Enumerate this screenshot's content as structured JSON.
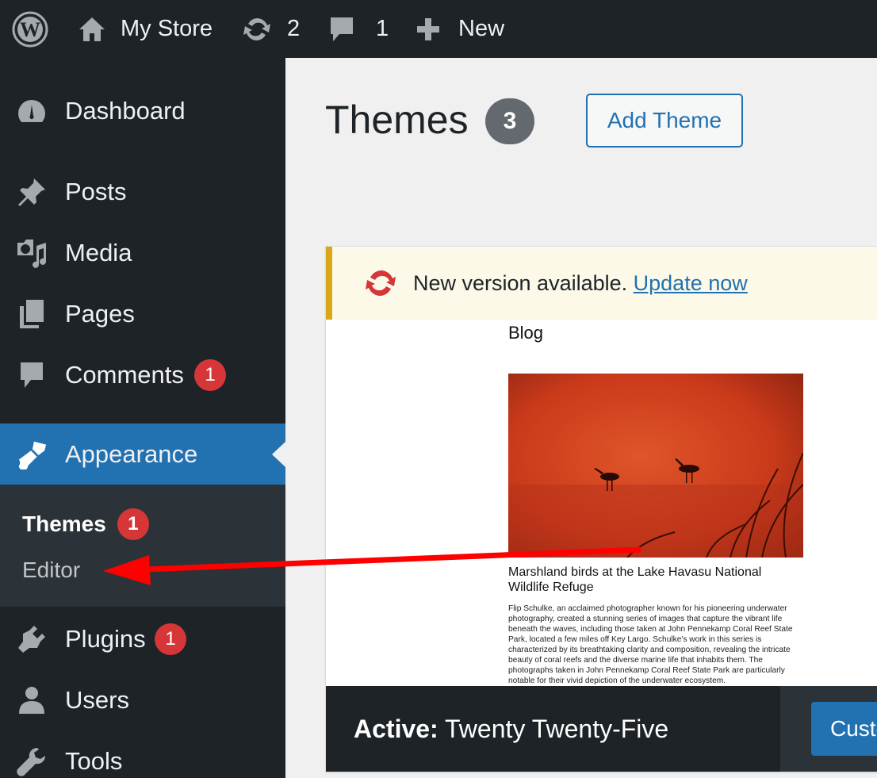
{
  "admin_bar": {
    "site_name": "My Store",
    "updates_count": "2",
    "comments_count": "1",
    "new_label": "New"
  },
  "sidebar": {
    "items": [
      {
        "label": "Dashboard",
        "icon": "dashboard-icon"
      },
      {
        "label": "Posts",
        "icon": "pin-icon"
      },
      {
        "label": "Media",
        "icon": "media-icon"
      },
      {
        "label": "Pages",
        "icon": "pages-icon"
      },
      {
        "label": "Comments",
        "icon": "comment-icon",
        "badge": "1"
      },
      {
        "label": "Appearance",
        "icon": "paintbrush-icon",
        "current": true
      },
      {
        "label": "Plugins",
        "icon": "plug-icon",
        "badge": "1"
      },
      {
        "label": "Users",
        "icon": "user-icon"
      },
      {
        "label": "Tools",
        "icon": "wrench-icon"
      }
    ],
    "submenu": [
      {
        "label": "Themes",
        "badge": "1",
        "active": true
      },
      {
        "label": "Editor"
      }
    ]
  },
  "main": {
    "title": "Themes",
    "count": "3",
    "add_button": "Add Theme"
  },
  "theme_card": {
    "notice_text": "New version available.",
    "notice_link": "Update now",
    "screenshot": {
      "heading": "Blog",
      "caption": "Marshland birds at the Lake Havasu National Wildlife Refuge",
      "body": "Flip Schulke, an acclaimed photographer known for his pioneering underwater photography, created a stunning series of images that capture the vibrant life beneath the waves, including those taken at John Pennekamp Coral Reef State Park, located a few miles off Key Largo. Schulke's work in this series is characterized by its breathtaking clarity and composition, revealing the intricate beauty of coral reefs and the diverse marine life that inhabits them. The photographs taken in John Pennekamp Coral Reef State Park are particularly notable for their vivid depiction of the underwater ecosystem."
    },
    "active_prefix": "Active:",
    "active_name": "Twenty Twenty-Five",
    "customize_label": "Customize"
  },
  "colors": {
    "admin_dark": "#1d2327",
    "accent": "#2271b1",
    "badge": "#d63638",
    "annotation_arrow": "#ff0000"
  }
}
